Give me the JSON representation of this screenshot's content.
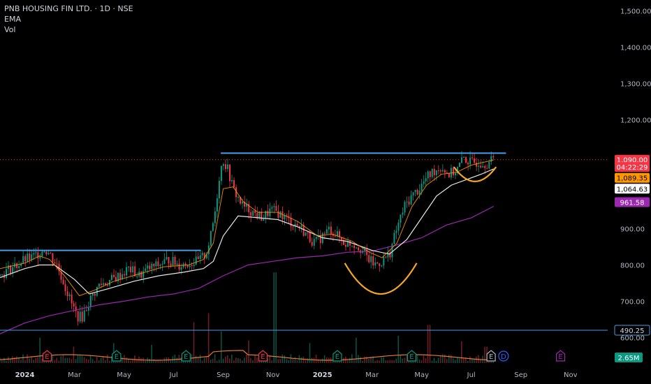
{
  "header": {
    "title": "PNB HOUSING FIN LTD. · 1D · NSE",
    "indicator_1": "EMA",
    "indicator_2": "Vol"
  },
  "chart_data": {
    "type": "candlestick",
    "symbol": "PNB HOUSING FIN LTD.",
    "interval": "1D",
    "exchange": "NSE",
    "y_ticks": [
      "1,500.00",
      "1,400.00",
      "1,300.00",
      "1,200.00",
      "900.00",
      "800.00",
      "700.00",
      "600.00"
    ],
    "y_tick_values": [
      1500,
      1400,
      1300,
      1200,
      900,
      800,
      700,
      600
    ],
    "ylim": [
      520,
      1530
    ],
    "x_ticks": [
      {
        "label": "2024",
        "t": 0.0,
        "year": true
      },
      {
        "label": "Mar",
        "t": 2.0,
        "year": false
      },
      {
        "label": "May",
        "t": 4.0,
        "year": false
      },
      {
        "label": "Jul",
        "t": 6.0,
        "year": false
      },
      {
        "label": "Sep",
        "t": 8.0,
        "year": false
      },
      {
        "label": "Nov",
        "t": 10.0,
        "year": false
      },
      {
        "label": "2025",
        "t": 12.0,
        "year": true
      },
      {
        "label": "Mar",
        "t": 14.0,
        "year": false
      },
      {
        "label": "May",
        "t": 16.0,
        "year": false
      },
      {
        "label": "Jul",
        "t": 18.0,
        "year": false
      },
      {
        "label": "Sep",
        "t": 20.0,
        "year": false
      },
      {
        "label": "Nov",
        "t": 22.0,
        "year": false
      }
    ],
    "xlim": [
      -1.0,
      23.5
    ],
    "price_path": [
      [
        -1.0,
        770
      ],
      [
        -0.6,
        790
      ],
      [
        -0.3,
        800
      ],
      [
        0.0,
        815
      ],
      [
        0.3,
        820
      ],
      [
        0.6,
        835
      ],
      [
        0.8,
        845
      ],
      [
        1.0,
        830
      ],
      [
        1.3,
        800
      ],
      [
        1.6,
        745
      ],
      [
        1.9,
        690
      ],
      [
        2.1,
        660
      ],
      [
        2.3,
        655
      ],
      [
        2.6,
        700
      ],
      [
        3.0,
        745
      ],
      [
        3.4,
        755
      ],
      [
        3.8,
        770
      ],
      [
        4.2,
        790
      ],
      [
        4.6,
        770
      ],
      [
        5.0,
        790
      ],
      [
        5.4,
        800
      ],
      [
        5.8,
        815
      ],
      [
        6.2,
        800
      ],
      [
        6.6,
        805
      ],
      [
        7.0,
        810
      ],
      [
        7.3,
        830
      ],
      [
        7.5,
        880
      ],
      [
        7.7,
        960
      ],
      [
        7.85,
        1050
      ],
      [
        8.0,
        1090
      ],
      [
        8.2,
        1060
      ],
      [
        8.4,
        1010
      ],
      [
        8.6,
        985
      ],
      [
        8.8,
        960
      ],
      [
        9.0,
        955
      ],
      [
        9.3,
        940
      ],
      [
        9.6,
        930
      ],
      [
        9.9,
        950
      ],
      [
        10.2,
        945
      ],
      [
        10.5,
        930
      ],
      [
        10.8,
        915
      ],
      [
        11.1,
        905
      ],
      [
        11.4,
        880
      ],
      [
        11.7,
        860
      ],
      [
        12.0,
        880
      ],
      [
        12.3,
        900
      ],
      [
        12.6,
        880
      ],
      [
        12.9,
        860
      ],
      [
        13.2,
        860
      ],
      [
        13.5,
        850
      ],
      [
        13.8,
        820
      ],
      [
        14.1,
        800
      ],
      [
        14.4,
        810
      ],
      [
        14.7,
        830
      ],
      [
        15.0,
        900
      ],
      [
        15.3,
        960
      ],
      [
        15.6,
        990
      ],
      [
        15.9,
        1010
      ],
      [
        16.2,
        1040
      ],
      [
        16.5,
        1060
      ],
      [
        16.8,
        1070
      ],
      [
        17.1,
        1050
      ],
      [
        17.4,
        1060
      ],
      [
        17.7,
        1095
      ],
      [
        18.0,
        1080
      ],
      [
        18.3,
        1085
      ],
      [
        18.6,
        1080
      ],
      [
        18.9,
        1090
      ]
    ],
    "ema_fast": [
      [
        -1.0,
        790
      ],
      [
        0.0,
        805
      ],
      [
        0.6,
        825
      ],
      [
        1.0,
        815
      ],
      [
        1.6,
        770
      ],
      [
        2.2,
        715
      ],
      [
        2.8,
        730
      ],
      [
        3.6,
        755
      ],
      [
        4.6,
        775
      ],
      [
        5.6,
        795
      ],
      [
        6.6,
        800
      ],
      [
        7.2,
        815
      ],
      [
        7.6,
        860
      ],
      [
        8.0,
        1010
      ],
      [
        8.4,
        1015
      ],
      [
        8.8,
        975
      ],
      [
        9.4,
        945
      ],
      [
        10.2,
        945
      ],
      [
        11.0,
        920
      ],
      [
        11.8,
        880
      ],
      [
        12.4,
        885
      ],
      [
        13.2,
        865
      ],
      [
        13.9,
        835
      ],
      [
        14.4,
        820
      ],
      [
        15.0,
        860
      ],
      [
        15.6,
        960
      ],
      [
        16.2,
        1020
      ],
      [
        16.8,
        1050
      ],
      [
        17.4,
        1055
      ],
      [
        18.0,
        1075
      ],
      [
        18.9,
        1089.35
      ]
    ],
    "ema_slow": [
      [
        -1.0,
        765
      ],
      [
        0.0,
        790
      ],
      [
        0.6,
        800
      ],
      [
        1.2,
        800
      ],
      [
        2.0,
        760
      ],
      [
        2.6,
        720
      ],
      [
        3.4,
        735
      ],
      [
        4.4,
        755
      ],
      [
        5.4,
        770
      ],
      [
        6.4,
        780
      ],
      [
        7.2,
        790
      ],
      [
        7.6,
        810
      ],
      [
        8.0,
        880
      ],
      [
        8.6,
        935
      ],
      [
        9.4,
        930
      ],
      [
        10.2,
        925
      ],
      [
        11.0,
        905
      ],
      [
        12.0,
        875
      ],
      [
        13.0,
        865
      ],
      [
        14.0,
        840
      ],
      [
        14.7,
        830
      ],
      [
        15.4,
        870
      ],
      [
        16.0,
        930
      ],
      [
        16.6,
        990
      ],
      [
        17.2,
        1020
      ],
      [
        17.8,
        1035
      ],
      [
        18.4,
        1050
      ],
      [
        18.9,
        1064.63
      ]
    ],
    "ema_long": [
      [
        -1.0,
        610
      ],
      [
        0.0,
        640
      ],
      [
        1.0,
        660
      ],
      [
        2.0,
        675
      ],
      [
        3.0,
        690
      ],
      [
        4.0,
        700
      ],
      [
        5.0,
        712
      ],
      [
        6.0,
        720
      ],
      [
        7.0,
        735
      ],
      [
        8.0,
        770
      ],
      [
        9.0,
        800
      ],
      [
        10.0,
        810
      ],
      [
        11.0,
        820
      ],
      [
        12.0,
        825
      ],
      [
        13.0,
        835
      ],
      [
        14.0,
        838
      ],
      [
        15.0,
        855
      ],
      [
        16.0,
        875
      ],
      [
        17.0,
        910
      ],
      [
        18.0,
        930
      ],
      [
        18.9,
        961.58
      ]
    ],
    "resistance_lines": [
      {
        "t_start": -1.0,
        "t_end": 7.1,
        "value": 840,
        "color": "#4a9ce8"
      },
      {
        "t_start": 7.9,
        "t_end": 19.4,
        "value": 1108,
        "color": "#4a9ce8"
      }
    ],
    "cup_arcs": [
      {
        "t_start": 12.9,
        "t_end": 15.8,
        "top": 805,
        "bottom": 720,
        "color": "#f5a623"
      },
      {
        "t_start": 17.3,
        "t_end": 19.0,
        "top": 1070,
        "bottom": 1030,
        "color": "#f5a623"
      }
    ],
    "current_price_line": {
      "value": 1090,
      "color": "#f23645"
    },
    "price_tags": [
      {
        "text": "1,090.00",
        "value": 1090,
        "bg": "#f23645",
        "fg": "#ffffff"
      },
      {
        "text": "04:22:29",
        "value": 1070,
        "bg": "#f23645",
        "fg": "#ffffff"
      },
      {
        "text": "1,089.35",
        "value": 1040,
        "bg": "#ff9800",
        "fg": "#000000"
      },
      {
        "text": "1,064.63",
        "value": 1010,
        "bg": "#ffffff",
        "fg": "#000000"
      },
      {
        "text": "961.58",
        "value": 973,
        "bg": "#9c27b0",
        "fg": "#ffffff"
      }
    ],
    "volume_line": {
      "value": 490.25,
      "label": "490.25",
      "color": "#4a9ce8"
    },
    "volume_tag": {
      "text": "2.65M",
      "bg": "#089981",
      "fg": "#ffffff"
    },
    "volume_spikes": [
      {
        "t": 0.6,
        "h": 0.28
      },
      {
        "t": 2.0,
        "h": 0.18
      },
      {
        "t": 3.6,
        "h": 0.22
      },
      {
        "t": 5.1,
        "h": 0.2
      },
      {
        "t": 6.8,
        "h": 0.45
      },
      {
        "t": 7.4,
        "h": 0.55
      },
      {
        "t": 7.9,
        "h": 0.35
      },
      {
        "t": 9.0,
        "h": 0.25
      },
      {
        "t": 10.1,
        "h": 1.0
      },
      {
        "t": 11.5,
        "h": 0.22
      },
      {
        "t": 13.4,
        "h": 0.28
      },
      {
        "t": 15.1,
        "h": 0.3
      },
      {
        "t": 16.3,
        "h": 0.42
      },
      {
        "t": 17.6,
        "h": 0.24
      },
      {
        "t": 18.6,
        "h": 0.18
      }
    ],
    "earnings_markers": [
      {
        "t": 0.9,
        "label": "E",
        "color": "#f23645"
      },
      {
        "t": 3.7,
        "label": "E",
        "color": "#089981"
      },
      {
        "t": 6.5,
        "label": "E",
        "color": "#089981"
      },
      {
        "t": 9.6,
        "label": "E",
        "color": "#f23645"
      },
      {
        "t": 12.6,
        "label": "E",
        "color": "#089981"
      },
      {
        "t": 15.6,
        "label": "E",
        "color": "#089981"
      },
      {
        "t": 18.8,
        "label": "E",
        "color": "#b2b5be"
      },
      {
        "t": 19.3,
        "label": "D",
        "color": "#2962ff"
      },
      {
        "t": 21.6,
        "label": "E",
        "color": "#9c27b0"
      }
    ]
  }
}
